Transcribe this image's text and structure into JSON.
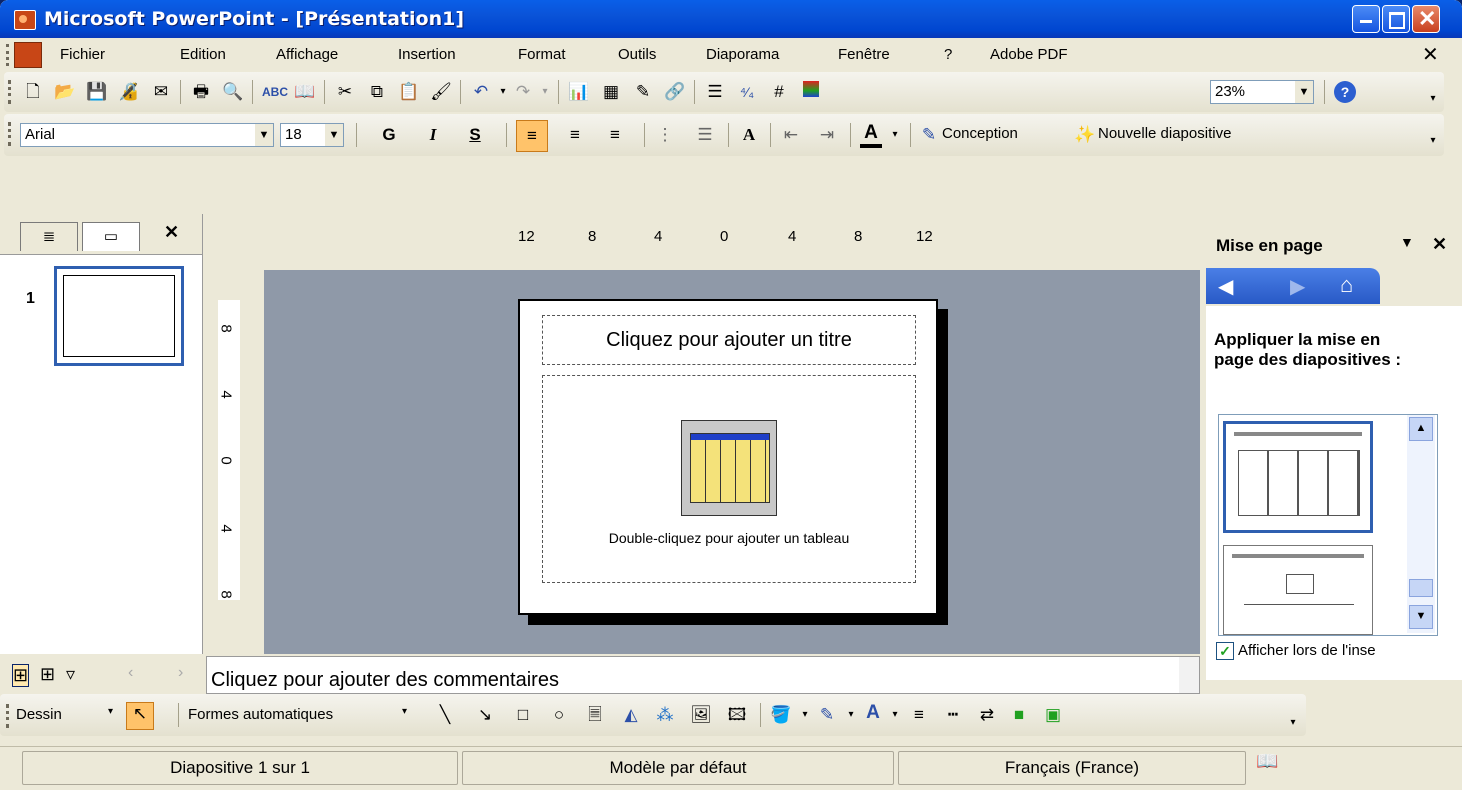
{
  "window": {
    "title": "Microsoft PowerPoint - [Présentation1]"
  },
  "menu": [
    "Fichier",
    "Edition",
    "Affichage",
    "Insertion",
    "Format",
    "Outils",
    "Diaporama",
    "Fenêtre",
    "?",
    "Adobe PDF"
  ],
  "standard_toolbar": {
    "zoom": "23%"
  },
  "format_toolbar": {
    "font": "Arial",
    "size": "18",
    "bold": "G",
    "italic": "I",
    "shadow": "S",
    "conception_label": "Conception",
    "new_slide_label": "Nouvelle diapositive"
  },
  "slides_pane": {
    "slide_number": "1"
  },
  "rulers": {
    "horizontal": [
      "12",
      "8",
      "4",
      "0",
      "4",
      "8",
      "12"
    ],
    "vertical": [
      "8",
      "4",
      "0",
      "4",
      "8"
    ]
  },
  "slide": {
    "title_placeholder": "Cliquez pour ajouter un titre",
    "table_hint": "Double-cliquez pour ajouter un tableau"
  },
  "notes": {
    "placeholder": "Cliquez pour ajouter des commentaires"
  },
  "task_pane": {
    "title": "Mise en page",
    "heading": "Appliquer la mise en page des diapositives :",
    "show_checkbox_label": "Afficher lors de l'inse"
  },
  "drawing_toolbar": {
    "draw_label": "Dessin",
    "autoshapes_label": "Formes automatiques"
  },
  "status": {
    "slide": "Diapositive 1 sur 1",
    "template": "Modèle par défaut",
    "language": "Français (France)"
  }
}
